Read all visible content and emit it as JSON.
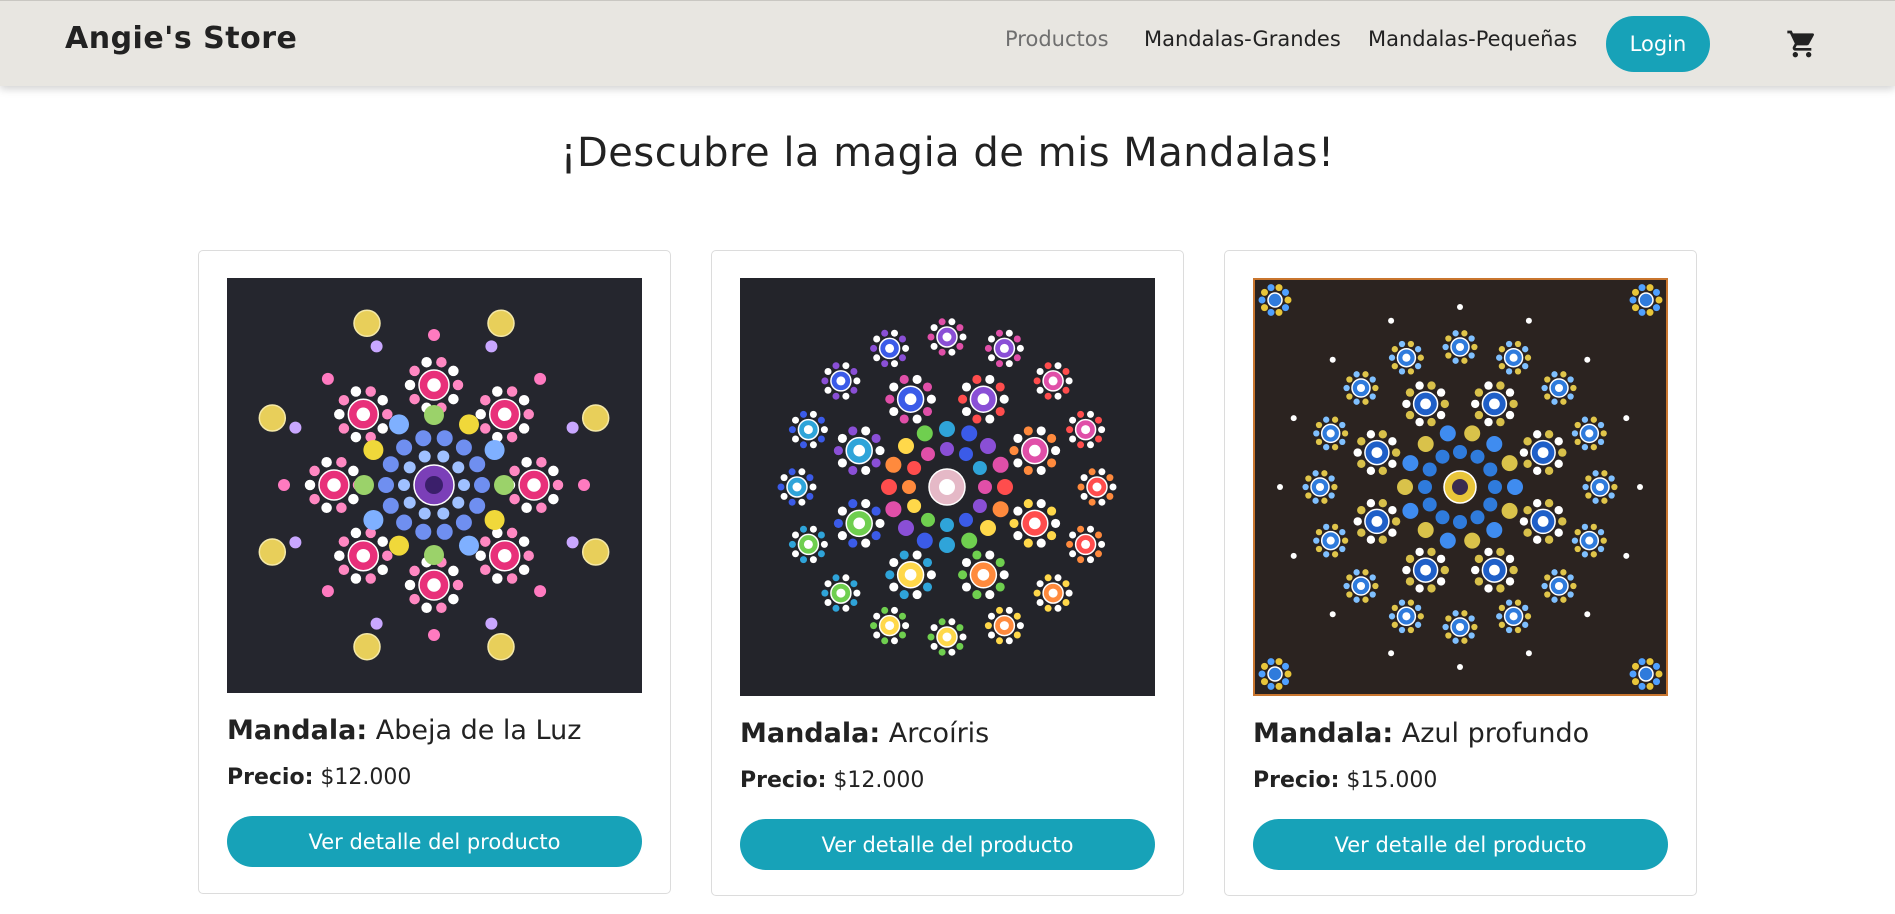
{
  "navbar": {
    "brand": "Angie's Store",
    "links": [
      {
        "label": "Productos",
        "active": true
      },
      {
        "label": "Mandalas-Grandes",
        "active": false
      },
      {
        "label": "Mandalas-Pequeñas",
        "active": false
      }
    ],
    "login_label": "Login",
    "cart_icon": "cart-icon"
  },
  "main": {
    "title": "¡Descubre la magia de mis Mandalas!"
  },
  "colors": {
    "accent": "#17a2b8",
    "navbar_bg": "#e8e6e1"
  },
  "products": [
    {
      "name_label": "Mandala:",
      "name": "Abeja de la Luz",
      "price_label": "Precio:",
      "price": "$12.000",
      "button_label": "Ver detalle del producto"
    },
    {
      "name_label": "Mandala:",
      "name": "Arcoíris",
      "price_label": "Precio:",
      "price": "$12.000",
      "button_label": "Ver detalle del producto"
    },
    {
      "name_label": "Mandala:",
      "name": "Azul profundo",
      "price_label": "Precio:",
      "price": "$15.000",
      "button_label": "Ver detalle del producto"
    }
  ]
}
